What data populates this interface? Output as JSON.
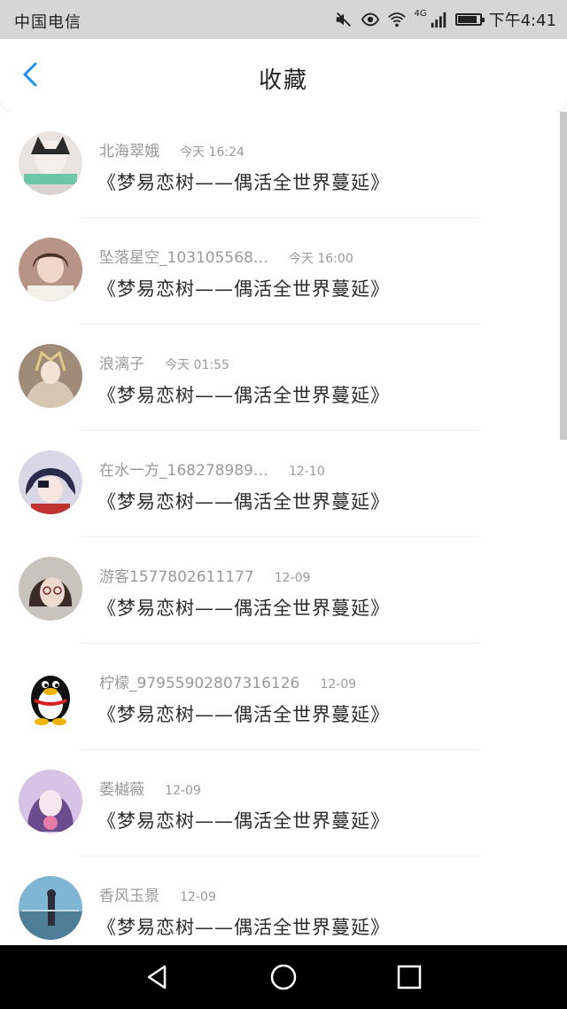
{
  "status_bar": {
    "carrier": "中国电信",
    "network": "4G",
    "time": "下午4:41",
    "battery_level": 0.9
  },
  "header": {
    "title": "收藏",
    "back_icon": "chevron-left-icon"
  },
  "colors": {
    "accent": "#1f8ef1",
    "meta": "#9a9a9a",
    "text": "#2a2a2a"
  },
  "favorites": [
    {
      "name": "北海翠娥",
      "time": "今天 16:24",
      "post": "《梦易恋树——偶活全世界蔓延》"
    },
    {
      "name": "坠落星空_103105568…",
      "time": "今天 16:00",
      "post": "《梦易恋树——偶活全世界蔓延》"
    },
    {
      "name": "浪漓子",
      "time": "今天 01:55",
      "post": "《梦易恋树——偶活全世界蔓延》"
    },
    {
      "name": "在水一方_168278989…",
      "time": "12-10",
      "post": "《梦易恋树——偶活全世界蔓延》"
    },
    {
      "name": "游客1577802611177",
      "time": "12-09",
      "post": "《梦易恋树——偶活全世界蔓延》"
    },
    {
      "name": "柠檬_97955902807316126",
      "time": "12-09",
      "post": "《梦易恋树——偶活全世界蔓延》"
    },
    {
      "name": "萎樾薇",
      "time": "12-09",
      "post": "《梦易恋树——偶活全世界蔓延》"
    },
    {
      "name": "香风玉景",
      "time": "12-09",
      "post": "《梦易恋树——偶活全世界蔓延》"
    }
  ],
  "nav_bar": {
    "back": "triangle-back-icon",
    "home": "circle-home-icon",
    "recent": "square-recents-icon"
  }
}
